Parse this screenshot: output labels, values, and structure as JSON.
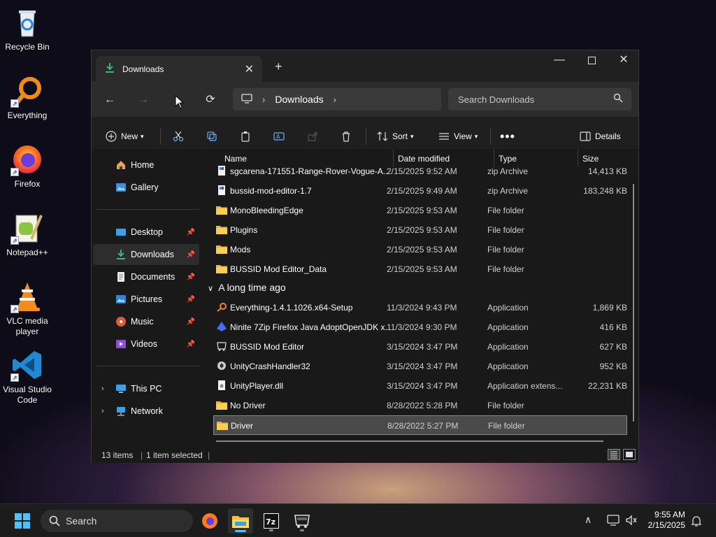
{
  "desktop": {
    "icons": [
      {
        "label": "Recycle Bin",
        "icon": "recycle-bin-icon"
      },
      {
        "label": "Everything",
        "icon": "everything-icon"
      },
      {
        "label": "Firefox",
        "icon": "firefox-icon"
      },
      {
        "label": "Notepad++",
        "icon": "notepad-plus-plus-icon"
      },
      {
        "label": "VLC media player",
        "icon": "vlc-icon"
      },
      {
        "label": "Visual Studio Code",
        "icon": "vscode-icon"
      }
    ]
  },
  "window": {
    "tab_title": "Downloads",
    "breadcrumb": [
      "Downloads"
    ],
    "search_placeholder": "Search Downloads",
    "toolbar": {
      "new_label": "New",
      "sort_label": "Sort",
      "view_label": "View",
      "details_label": "Details"
    },
    "sidebar": {
      "top": [
        {
          "label": "Home",
          "icon": "home-icon"
        },
        {
          "label": "Gallery",
          "icon": "gallery-icon"
        }
      ],
      "quick": [
        {
          "label": "Desktop",
          "icon": "desktop-folder-icon",
          "pinned": true
        },
        {
          "label": "Downloads",
          "icon": "download-icon",
          "pinned": true,
          "selected": true
        },
        {
          "label": "Documents",
          "icon": "documents-icon",
          "pinned": true
        },
        {
          "label": "Pictures",
          "icon": "pictures-icon",
          "pinned": true
        },
        {
          "label": "Music",
          "icon": "music-icon",
          "pinned": true
        },
        {
          "label": "Videos",
          "icon": "videos-icon",
          "pinned": true
        }
      ],
      "tree": [
        {
          "label": "This PC",
          "icon": "this-pc-icon"
        },
        {
          "label": "Network",
          "icon": "network-icon"
        }
      ]
    },
    "columns": {
      "name": "Name",
      "date": "Date modified",
      "type": "Type",
      "size": "Size"
    },
    "files_recent": [
      {
        "name": "sgcarena-171551-Range-Rover-Vogue-A...",
        "date": "2/15/2025 9:52 AM",
        "type": "zip Archive",
        "size": "14,413 KB",
        "icon": "zip-icon"
      },
      {
        "name": "bussid-mod-editor-1.7",
        "date": "2/15/2025 9:49 AM",
        "type": "zip Archive",
        "size": "183,248 KB",
        "icon": "zip-icon"
      },
      {
        "name": "MonoBleedingEdge",
        "date": "2/15/2025 9:53 AM",
        "type": "File folder",
        "size": "",
        "icon": "folder-icon"
      },
      {
        "name": "Plugins",
        "date": "2/15/2025 9:53 AM",
        "type": "File folder",
        "size": "",
        "icon": "folder-icon"
      },
      {
        "name": "Mods",
        "date": "2/15/2025 9:53 AM",
        "type": "File folder",
        "size": "",
        "icon": "folder-icon"
      },
      {
        "name": "BUSSID Mod Editor_Data",
        "date": "2/15/2025 9:53 AM",
        "type": "File folder",
        "size": "",
        "icon": "folder-icon"
      }
    ],
    "group_label": "A long time ago",
    "files_old": [
      {
        "name": "Everything-1.4.1.1026.x64-Setup",
        "date": "11/3/2024 9:43 PM",
        "type": "Application",
        "size": "1,869 KB",
        "icon": "everything-app-icon"
      },
      {
        "name": "Ninite 7Zip Firefox Java AdoptOpenJDK x...",
        "date": "11/3/2024 9:30 PM",
        "type": "Application",
        "size": "416 KB",
        "icon": "ninite-icon"
      },
      {
        "name": "BUSSID Mod Editor",
        "date": "3/15/2024 3:47 PM",
        "type": "Application",
        "size": "627 KB",
        "icon": "bus-icon"
      },
      {
        "name": "UnityCrashHandler32",
        "date": "3/15/2024 3:47 PM",
        "type": "Application",
        "size": "952 KB",
        "icon": "unity-icon"
      },
      {
        "name": "UnityPlayer.dll",
        "date": "3/15/2024 3:47 PM",
        "type": "Application extens...",
        "size": "22,231 KB",
        "icon": "dll-icon"
      },
      {
        "name": "No Driver",
        "date": "8/28/2022 5:28 PM",
        "type": "File folder",
        "size": "",
        "icon": "folder-icon"
      },
      {
        "name": "Driver",
        "date": "8/28/2022 5:27 PM",
        "type": "File folder",
        "size": "",
        "icon": "folder-icon",
        "selected": true
      }
    ],
    "status": {
      "count": "13 items",
      "selection": "1 item selected"
    }
  },
  "taskbar": {
    "search_label": "Search",
    "time": "9:55 AM",
    "date": "2/15/2025"
  }
}
